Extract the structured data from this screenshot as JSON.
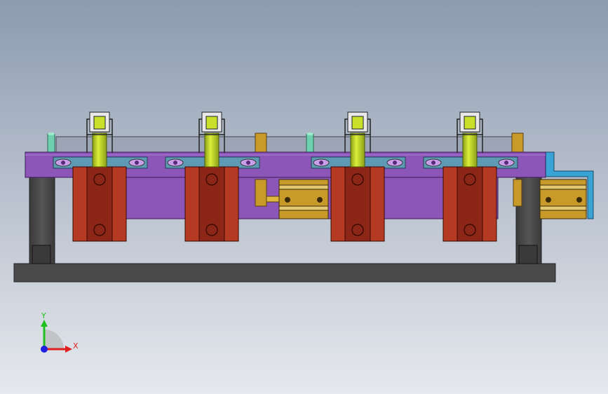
{
  "view": {
    "background_top": "#8d9bb0",
    "background_bottom": "#e6e9ee"
  },
  "colors": {
    "base_plate": "#4a4a4a",
    "legs": "#454545",
    "main_plate": "#8c55b8",
    "main_plate_dark": "#6e3f9a",
    "top_rail": "#5f9ab5",
    "cylinder_body": "#b43a24",
    "cylinder_dark": "#6e1a10",
    "piston_rod": "#c9e02a",
    "clamp_arm": "#e8e8e8",
    "guide_pin": "#6fd0b0",
    "gold_part": "#c89a2a",
    "bracket": "#3aa3d6"
  },
  "triad": {
    "x_label": "X",
    "y_label": "Y",
    "x_color": "#e02020",
    "y_color": "#20c020",
    "z_color": "#2020e0"
  },
  "clamps": [
    "clamp-1",
    "clamp-2",
    "clamp-3",
    "clamp-4"
  ]
}
